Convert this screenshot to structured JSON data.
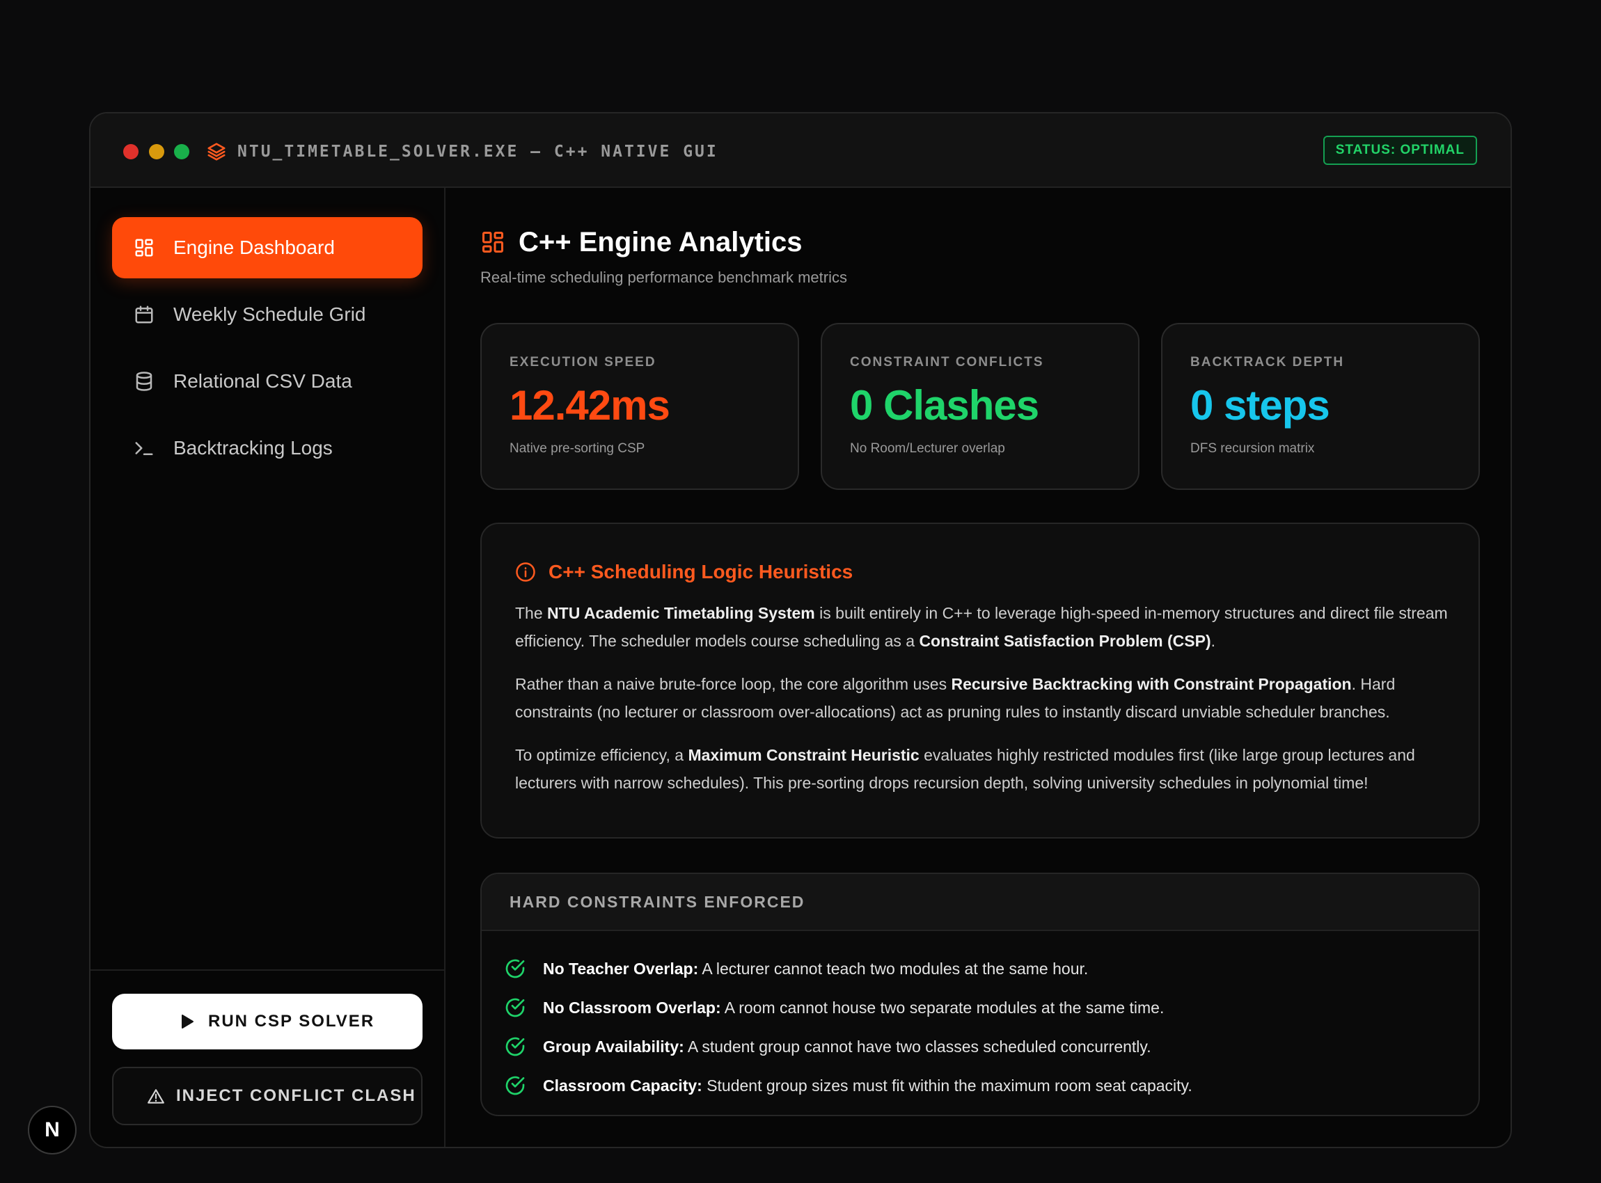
{
  "window": {
    "title": "NTU_TIMETABLE_SOLVER.EXE — C++ NATIVE GUI",
    "status": "STATUS: OPTIMAL"
  },
  "sidebar": {
    "items": [
      {
        "label": "Engine Dashboard",
        "icon": "dashboard-icon",
        "active": true
      },
      {
        "label": "Weekly Schedule Grid",
        "icon": "calendar-icon",
        "active": false
      },
      {
        "label": "Relational CSV Data",
        "icon": "database-icon",
        "active": false
      },
      {
        "label": "Backtracking Logs",
        "icon": "terminal-icon",
        "active": false
      }
    ],
    "run_button": "RUN CSP SOLVER",
    "inject_button": "INJECT CONFLICT CLASH"
  },
  "main": {
    "title": "C++ Engine Analytics",
    "subtitle": "Real-time scheduling performance benchmark metrics",
    "stats": [
      {
        "label": "EXECUTION SPEED",
        "value": "12.42ms",
        "desc": "Native pre-sorting CSP",
        "color": "#ff4a12"
      },
      {
        "label": "CONSTRAINT CONFLICTS",
        "value": "0 Clashes",
        "desc": "No Room/Lecturer overlap",
        "color": "#1fd46a"
      },
      {
        "label": "BACKTRACK DEPTH",
        "value": "0 steps",
        "desc": "DFS recursion matrix",
        "color": "#17c6ec"
      }
    ],
    "heuristics": {
      "title": "C++ Scheduling Logic Heuristics",
      "p1": {
        "t1": "The ",
        "b1": "NTU Academic Timetabling System",
        "t2": " is built entirely in C++ to leverage high-speed in-memory structures and direct file stream efficiency. The scheduler models course scheduling as a ",
        "b2": "Constraint Satisfaction Problem (CSP)",
        "t3": "."
      },
      "p2": {
        "t1": "Rather than a naive brute-force loop, the core algorithm uses ",
        "b1": "Recursive Backtracking with Constraint Propagation",
        "t2": ". Hard constraints (no lecturer or classroom over-allocations) act as pruning rules to instantly discard unviable scheduler branches."
      },
      "p3": {
        "t1": "To optimize efficiency, a ",
        "b1": "Maximum Constraint Heuristic",
        "t2": " evaluates highly restricted modules first (like large group lectures and lecturers with narrow schedules). This pre-sorting drops recursion depth, solving university schedules in polynomial time!"
      }
    },
    "constraints": {
      "title": "HARD CONSTRAINTS ENFORCED",
      "items": [
        {
          "name": "No Teacher Overlap:",
          "desc": " A lecturer cannot teach two modules at the same hour."
        },
        {
          "name": "No Classroom Overlap:",
          "desc": " A room cannot house two separate modules at the same time."
        },
        {
          "name": "Group Availability:",
          "desc": " A student group cannot have two classes scheduled concurrently."
        },
        {
          "name": "Classroom Capacity:",
          "desc": " Student group sizes must fit within the maximum room seat capacity."
        }
      ]
    }
  },
  "badge": {
    "letter": "N"
  },
  "colors": {
    "accent": "#ff4a0a",
    "success": "#1fd46a",
    "info": "#17c6ec"
  }
}
